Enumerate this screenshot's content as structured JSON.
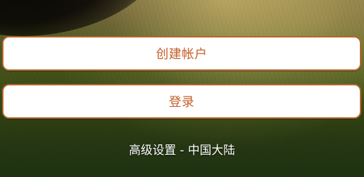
{
  "buttons": {
    "create_account_label": "创建帐户",
    "login_label": "登录"
  },
  "footer": {
    "advanced_settings_link": "高级设置 - 中国大陆"
  },
  "colors": {
    "accent_text": "#c45f2a",
    "button_border": "#b7652d",
    "button_fill": "#ffffff",
    "footer_text": "#ffffff"
  },
  "background": {
    "scene": "golf-course-grass"
  }
}
